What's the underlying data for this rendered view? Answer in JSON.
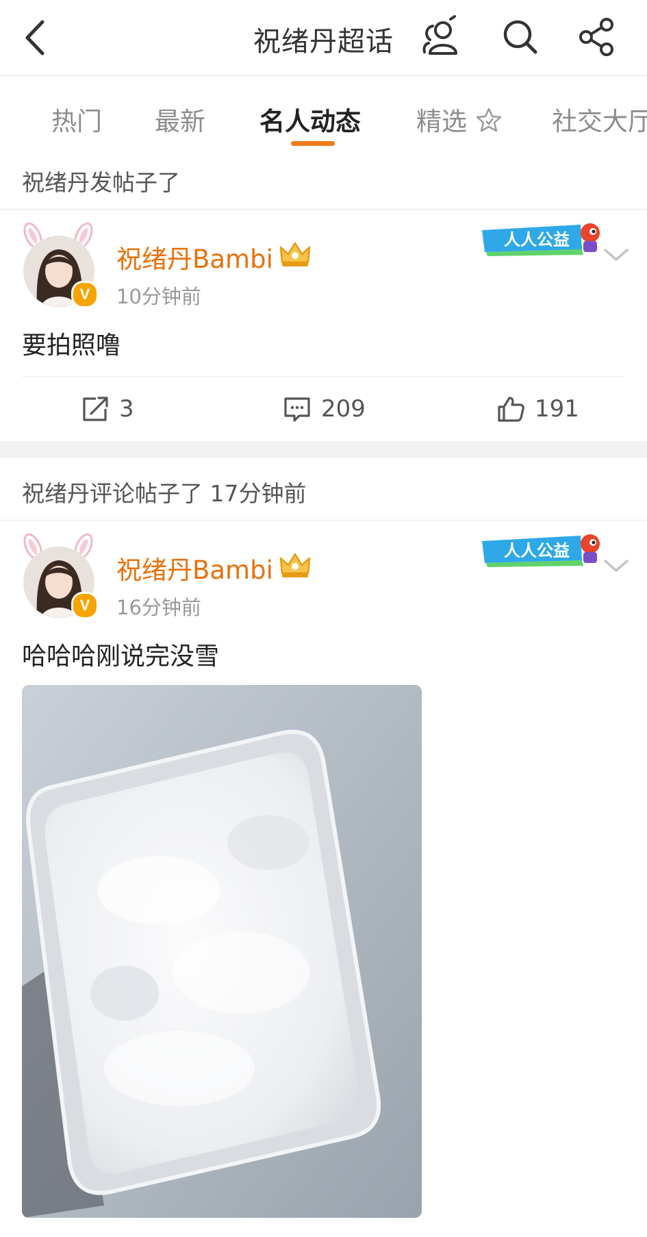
{
  "header": {
    "title": "祝绪丹超话"
  },
  "tabs": [
    "热门",
    "最新",
    "名人动态",
    "精选",
    "社交大厅"
  ],
  "active_tab": "名人动态",
  "feed": [
    {
      "section_label": "祝绪丹发帖子了",
      "username": "祝绪丹Bambi",
      "time": "10分钟前",
      "text": "要拍照噜",
      "reposts": "3",
      "comments": "209",
      "likes": "191",
      "badge_text": "人人公益",
      "verified_mark": "V"
    },
    {
      "section_label": "祝绪丹评论帖子了 17分钟前",
      "username": "祝绪丹Bambi",
      "time": "16分钟前",
      "text": "哈哈哈刚说完没雪",
      "badge_text": "人人公益",
      "verified_mark": "V"
    }
  ],
  "colors": {
    "accent": "#f07a1a",
    "username": "#e8710a",
    "badge_blue": "#2fa8e8"
  }
}
